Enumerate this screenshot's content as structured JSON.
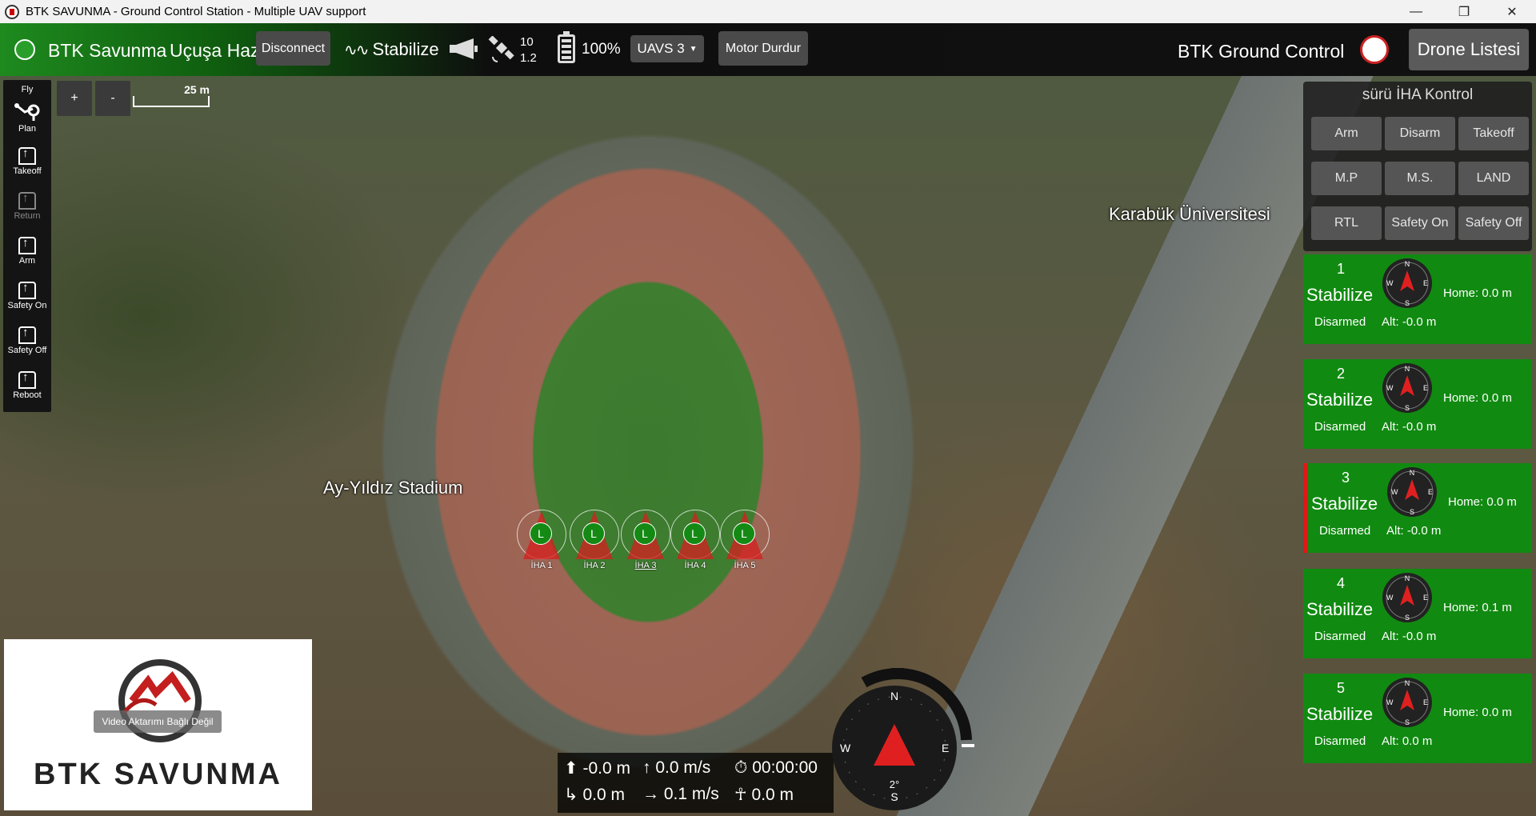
{
  "window": {
    "title": "BTK SAVUNMA - Ground Control Station - Multiple UAV support",
    "minimize": "—",
    "maximize": "❐",
    "close": "✕"
  },
  "toolbar": {
    "brand": "BTK Savunma",
    "ready_status": "Uçuşa Hazır",
    "disconnect_label": "Disconnect",
    "flight_mode": "Stabilize",
    "satellite_count": "10",
    "hdop": "1.2",
    "battery_percent": "100%",
    "uav_selector": "UAVS 3",
    "motor_stop_label": "Motor Durdur",
    "ground_control_title": "BTK Ground Control",
    "drone_list_label": "Drone Listesi"
  },
  "tools": [
    {
      "label": "Fly"
    },
    {
      "label": "Plan"
    },
    {
      "label": "Takeoff"
    },
    {
      "label": "Return"
    },
    {
      "label": "Arm"
    },
    {
      "label": "Safety On"
    },
    {
      "label": "Safety Off"
    },
    {
      "label": "Reboot"
    }
  ],
  "map": {
    "zoom_in": "+",
    "zoom_out": "-",
    "scale_label": "25 m",
    "labels": {
      "stadium": "Ay-Yıldız Stadium",
      "university": "Karabük Üniversitesi"
    },
    "uav_markers": [
      {
        "letter": "L",
        "label": "İHA 1"
      },
      {
        "letter": "L",
        "label": "İHA 2"
      },
      {
        "letter": "L",
        "label": "İHA 3"
      },
      {
        "letter": "L",
        "label": "İHA 4"
      },
      {
        "letter": "L",
        "label": "İHA 5"
      }
    ]
  },
  "swarm_panel": {
    "title": "sürü İHA Kontrol",
    "buttons": [
      "Arm",
      "Disarm",
      "Takeoff",
      "M.P",
      "M.S.",
      "LAND",
      "RTL",
      "Safety On",
      "Safety Off"
    ]
  },
  "drones": [
    {
      "id": "1",
      "mode": "Stabilize",
      "arm_state": "Disarmed",
      "altitude": "Alt: -0.0 m",
      "home": "Home: 0.0 m"
    },
    {
      "id": "2",
      "mode": "Stabilize",
      "arm_state": "Disarmed",
      "altitude": "Alt: -0.0 m",
      "home": "Home: 0.0 m"
    },
    {
      "id": "3",
      "mode": "Stabilize",
      "arm_state": "Disarmed",
      "altitude": "Alt: -0.0 m",
      "home": "Home: 0.0 m"
    },
    {
      "id": "4",
      "mode": "Stabilize",
      "arm_state": "Disarmed",
      "altitude": "Alt: -0.0 m",
      "home": "Home: 0.1 m"
    },
    {
      "id": "5",
      "mode": "Stabilize",
      "arm_state": "Disarmed",
      "altitude": "Alt: 0.0 m",
      "home": "Home: 0.0 m"
    }
  ],
  "video": {
    "status": "Video Aktarımı Bağlı Değil",
    "wordmark": "BTK SAVUNMA"
  },
  "telemetry": {
    "altitude": "-0.0 m",
    "vertical_speed": "0.0 m/s",
    "flight_time": "00:00:00",
    "distance_home": "0.0 m",
    "ground_speed": "0.1 m/s",
    "distance_pilot": "0.0 m"
  },
  "compass": {
    "n": "N",
    "e": "E",
    "s": "S",
    "w": "W",
    "heading": "2°"
  },
  "colors": {
    "panel_green": "#118a11",
    "selected_red": "#e01818",
    "marker_green": "#148a14"
  }
}
